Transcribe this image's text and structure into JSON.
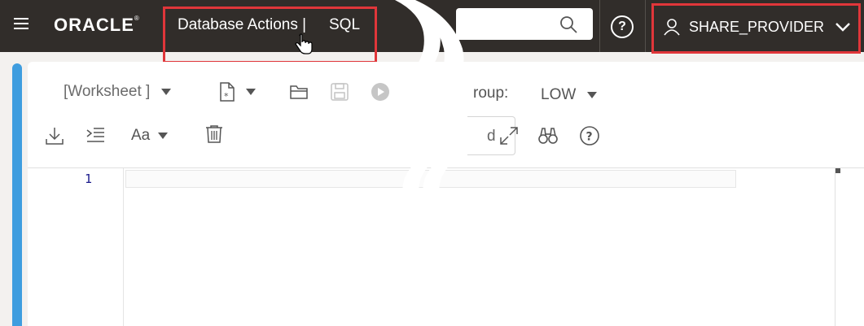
{
  "header": {
    "logo": "ORACLE",
    "logo_mark": "®",
    "app_title": "Database Actions |",
    "app_section": "SQL",
    "search_placeholder": "",
    "user": "SHARE_PROVIDER",
    "help_glyph": "?"
  },
  "toolbar": {
    "worksheet_label": "[Worksheet ]",
    "consumer_group_label": "roup:",
    "consumer_group_value": "LOW",
    "find_partial": "d",
    "font_glyph": "Aa"
  },
  "editor": {
    "line_numbers": [
      "1"
    ]
  },
  "colors": {
    "header_bg": "#312d2a",
    "highlight": "#e0363a",
    "accent_bar": "#3f9ddf"
  },
  "icons": [
    "menu-icon",
    "search-icon",
    "help-icon",
    "user-icon",
    "chevron-down-icon",
    "new-file-icon",
    "open-folder-icon",
    "save-icon",
    "run-icon",
    "download-icon",
    "format-icon",
    "font-size-icon",
    "trash-icon",
    "expand-icon",
    "binoculars-icon"
  ]
}
